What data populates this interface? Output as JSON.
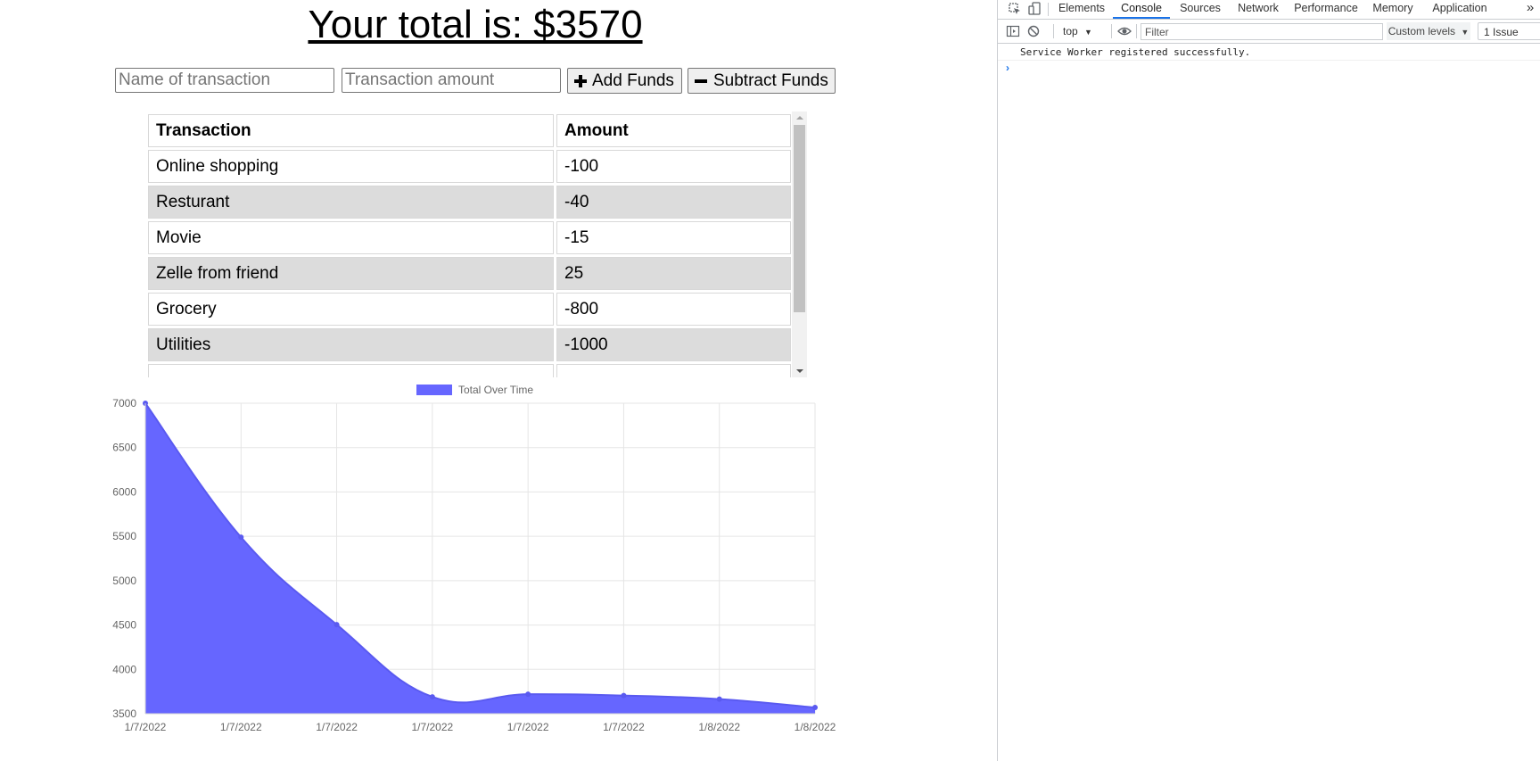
{
  "app": {
    "total_heading": "Your total is: $3570",
    "name_placeholder": "Name of transaction",
    "amount_placeholder": "Transaction amount",
    "add_funds_label": "Add Funds",
    "subtract_funds_label": "Subtract Funds",
    "table": {
      "headers": [
        "Transaction",
        "Amount"
      ],
      "rows": [
        {
          "name": "Online shopping",
          "amount": "-100"
        },
        {
          "name": "Resturant",
          "amount": "-40"
        },
        {
          "name": "Movie",
          "amount": "-15"
        },
        {
          "name": "Zelle from friend",
          "amount": "25"
        },
        {
          "name": "Grocery",
          "amount": "-800"
        },
        {
          "name": "Utilities",
          "amount": "-1000"
        }
      ]
    }
  },
  "chart_data": {
    "type": "area",
    "legend": "Total Over Time",
    "legend_position": "top",
    "fill_color": "#6666ff",
    "grid": true,
    "x": [
      "1/7/2022",
      "1/7/2022",
      "1/7/2022",
      "1/7/2022",
      "1/7/2022",
      "1/7/2022",
      "1/8/2022",
      "1/8/2022"
    ],
    "series": [
      {
        "name": "Total Over Time",
        "values": [
          7000,
          5490,
          4505,
          3690,
          3720,
          3705,
          3665,
          3570
        ]
      }
    ],
    "ylim": [
      3500,
      7000
    ],
    "yticks": [
      3500,
      4000,
      4500,
      5000,
      5500,
      6000,
      6500,
      7000
    ]
  },
  "devtools": {
    "tabs": [
      "Elements",
      "Console",
      "Sources",
      "Network",
      "Performance",
      "Memory",
      "Application"
    ],
    "active_tab": "Console",
    "context": "top",
    "filter_placeholder": "Filter",
    "levels": "Custom levels",
    "issues": "1 Issue",
    "console_message": "Service Worker registered successfully.",
    "prompt": "›",
    "more_tabs": "»"
  }
}
